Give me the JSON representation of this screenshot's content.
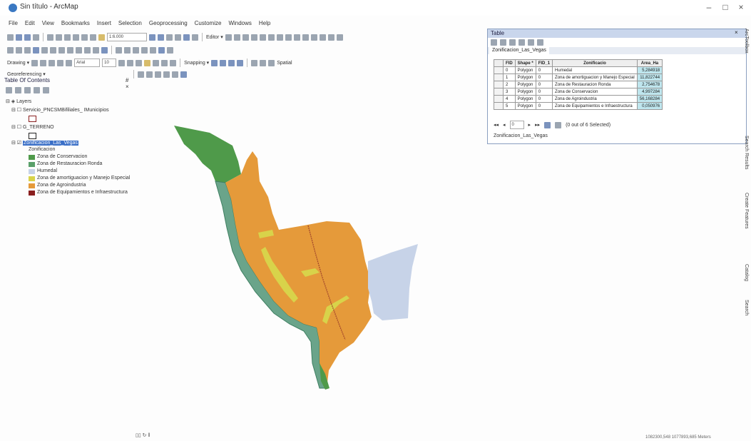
{
  "window": {
    "title": "Sin título - ArcMap",
    "min": "–",
    "max": "□",
    "close": "×"
  },
  "menu": [
    "File",
    "Edit",
    "View",
    "Bookmarks",
    "Insert",
    "Selection",
    "Geoprocessing",
    "Customize",
    "Windows",
    "Help"
  ],
  "toolbar": {
    "scale": "1:6.000",
    "drawing_label": "Drawing ▾",
    "georeferencing_label": "Georeferencing ▾",
    "snapping_label": "Snapping ▾",
    "editor_label": "Editor ▾",
    "spatial_label": "Spatial",
    "font_field": "Arial",
    "font_size": "10"
  },
  "toc": {
    "title": "Table Of Contents",
    "close": "# ×",
    "layers_root": "Layers",
    "layers": [
      {
        "name": "Servicio_PNCSMBifiliales_ IMunicipios"
      },
      {
        "name": "G_TERRENO"
      },
      {
        "name": "Zonificacion_Las_Vegas",
        "field": "Zonificacion"
      }
    ],
    "legend": [
      {
        "label": "Zona de Conservacion",
        "color": "#4f9a4a"
      },
      {
        "label": "Zona de Restauracion Ronda",
        "color": "#5aa06a"
      },
      {
        "label": "Humedal",
        "color": "#c7d3e8"
      },
      {
        "label": "Zona de amortiguacion y Manejo Especial",
        "color": "#d8d34a"
      },
      {
        "label": "Zona de Agroindustria",
        "color": "#e59a3a"
      },
      {
        "label": "Zona de Equipamientos e Infraestructura",
        "color": "#8a1f1f"
      }
    ]
  },
  "table": {
    "window_title": "Table",
    "tab": "Zonificacion_Las_Vegas",
    "columns": [
      "FID",
      "Shape *",
      "FID_1",
      "Zonificacio",
      "Area_Ha"
    ],
    "rows": [
      [
        "0",
        "Polygon",
        "0",
        "Humedal",
        "5,284918"
      ],
      [
        "1",
        "Polygon",
        "0",
        "Zona de amortiguacion y Manejo Especial",
        "11,822744"
      ],
      [
        "2",
        "Polygon",
        "0",
        "Zona de Restauracion Ronda",
        "2,754678"
      ],
      [
        "3",
        "Polygon",
        "0",
        "Zona de Conservacion",
        "4,997284"
      ],
      [
        "4",
        "Polygon",
        "0",
        "Zona de Agroindustria",
        "56,168284"
      ],
      [
        "5",
        "Polygon",
        "0",
        "Zona de Equipamientos e Infraestructura",
        "0,050976"
      ]
    ],
    "nav": "(0 out of 6 Selected)",
    "nav_first": "◂◂",
    "nav_prev": "◂",
    "nav_record": "0",
    "nav_next": "▸",
    "nav_last": "▸▸",
    "status_tab": "Zonificacion_Las_Vegas"
  },
  "dock": [
    "ArcToolbox",
    "Search Results",
    "Create Features",
    "Catalog",
    "Search"
  ],
  "status": {
    "left": "▯▯ ↻ ‖",
    "coords": "1082300,548 1077893,685 Meters"
  }
}
